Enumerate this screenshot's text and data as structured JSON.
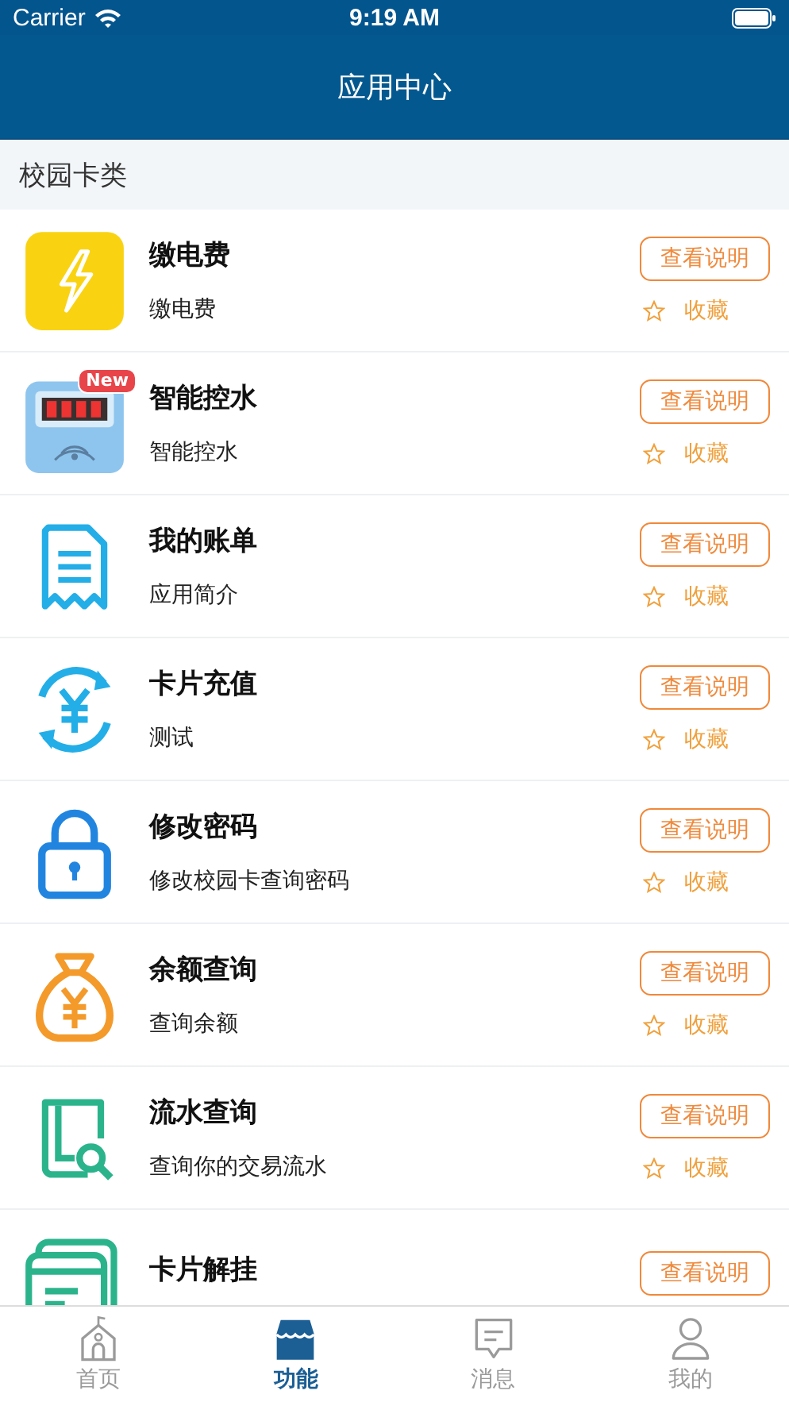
{
  "status_bar": {
    "carrier": "Carrier",
    "time": "9:19 AM"
  },
  "nav_bar": {
    "title": "应用中心"
  },
  "section": {
    "title": "校园卡类"
  },
  "apps": [
    {
      "title": "缴电费",
      "subtitle": "缴电费",
      "button": "查看说明",
      "favorite": "收藏",
      "favorited": false
    },
    {
      "title": "智能控水",
      "subtitle": "智能控水",
      "badge": "New",
      "button": "查看说明",
      "favorite": "收藏",
      "favorited": false
    },
    {
      "title": "我的账单",
      "subtitle": "应用简介",
      "button": "查看说明",
      "favorite": "收藏",
      "favorited": false
    },
    {
      "title": "卡片充值",
      "subtitle": "测试",
      "button": "查看说明",
      "favorite": "收藏",
      "favorited": false
    },
    {
      "title": "修改密码",
      "subtitle": "修改校园卡查询密码",
      "button": "查看说明",
      "favorite": "收藏",
      "favorited": false
    },
    {
      "title": "余额查询",
      "subtitle": "查询余额",
      "button": "查看说明",
      "favorite": "收藏",
      "favorited": false
    },
    {
      "title": "流水查询",
      "subtitle": "查询你的交易流水",
      "button": "查看说明",
      "favorite": "收藏",
      "favorited": false
    },
    {
      "title": "卡片解挂",
      "button": "查看说明"
    }
  ],
  "tab_bar": [
    {
      "label": "首页",
      "selected": false
    },
    {
      "label": "功能",
      "selected": true
    },
    {
      "label": "消息",
      "selected": false
    },
    {
      "label": "我的",
      "selected": false
    }
  ]
}
